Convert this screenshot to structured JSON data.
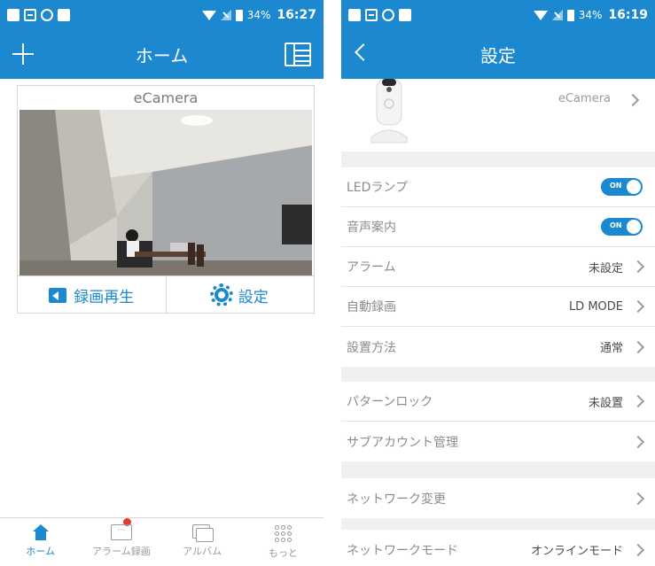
{
  "colors": {
    "brand": "#1b88cf",
    "background": "#eef0f2",
    "notification": "#e53c30"
  },
  "home_screen": {
    "status_bar": {
      "battery": "34%",
      "time": "16:27"
    },
    "header": {
      "title": "ホーム",
      "add_icon": "plus-icon",
      "list_icon": "list-view-icon"
    },
    "camera_card": {
      "name": "eCamera",
      "playback_label": "録画再生",
      "settings_label": "設定"
    },
    "tabs": [
      {
        "label": "ホーム",
        "icon": "home-icon",
        "active": true
      },
      {
        "label": "アラーム録画",
        "icon": "message-icon",
        "active": false
      },
      {
        "label": "アルバム",
        "icon": "album-icon",
        "active": false
      },
      {
        "label": "もっと",
        "icon": "more-icon",
        "active": false
      }
    ]
  },
  "settings_screen": {
    "status_bar": {
      "battery": "34%",
      "time": "16:19"
    },
    "header": {
      "title": "設定",
      "back_icon": "back-icon"
    },
    "device": {
      "name": "eCamera"
    },
    "group1": [
      {
        "label": "LEDランプ",
        "toggle": "ON"
      },
      {
        "label": "音声案内",
        "toggle": "ON"
      },
      {
        "label": "アラーム",
        "value": "未設定"
      },
      {
        "label": "自動録画",
        "value": "LD MODE"
      },
      {
        "label": "設置方法",
        "value": "通常"
      }
    ],
    "group2": [
      {
        "label": "パターンロック",
        "value": "未設置"
      },
      {
        "label": "サブアカウント管理",
        "value": ""
      }
    ],
    "group3": [
      {
        "label": "ネットワーク変更",
        "value": ""
      }
    ],
    "group4": [
      {
        "label": "ネットワークモード",
        "value": "オンラインモード"
      }
    ]
  }
}
